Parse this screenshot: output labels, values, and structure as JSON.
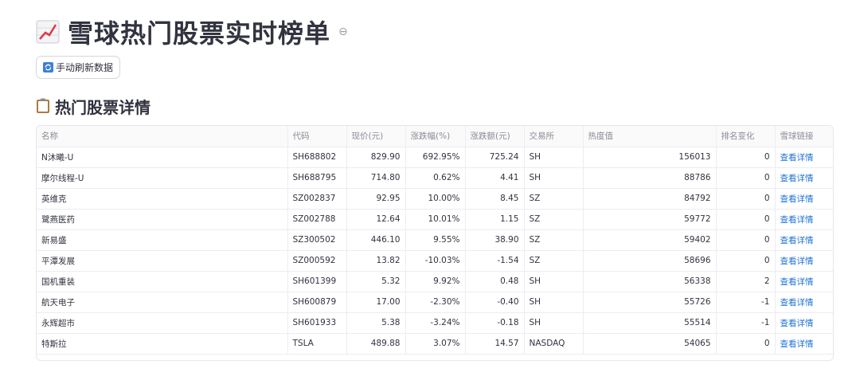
{
  "page": {
    "title": "雪球热门股票实时榜单",
    "title_icon": "chart-increasing-icon",
    "anchor_icon": "link-icon",
    "refresh_button": "手动刷新数据",
    "refresh_icon": "refresh-icon",
    "section_title": "热门股票详情",
    "section_icon": "clipboard-icon"
  },
  "colors": {
    "link": "#1e73d6",
    "text": "#31333f",
    "header_text": "#8a8c95"
  },
  "table": {
    "columns": [
      "名称",
      "代码",
      "现价(元)",
      "涨跌幅(%)",
      "涨跌额(元)",
      "交易所",
      "热度值",
      "排名变化",
      "雪球链接"
    ],
    "rows": [
      [
        "N沐曦-U",
        "SH688802",
        "829.90",
        "692.95%",
        "725.24",
        "SH",
        "156013",
        "0",
        "查看详情"
      ],
      [
        "摩尔线程-U",
        "SH688795",
        "714.80",
        "0.62%",
        "4.41",
        "SH",
        "88786",
        "0",
        "查看详情"
      ],
      [
        "英维克",
        "SZ002837",
        "92.95",
        "10.00%",
        "8.45",
        "SZ",
        "84792",
        "0",
        "查看详情"
      ],
      [
        "鹭燕医药",
        "SZ002788",
        "12.64",
        "10.01%",
        "1.15",
        "SZ",
        "59772",
        "0",
        "查看详情"
      ],
      [
        "新易盛",
        "SZ300502",
        "446.10",
        "9.55%",
        "38.90",
        "SZ",
        "59402",
        "0",
        "查看详情"
      ],
      [
        "平潭发展",
        "SZ000592",
        "13.82",
        "-10.03%",
        "-1.54",
        "SZ",
        "58696",
        "0",
        "查看详情"
      ],
      [
        "国机重装",
        "SH601399",
        "5.32",
        "9.92%",
        "0.48",
        "SH",
        "56338",
        "2",
        "查看详情"
      ],
      [
        "航天电子",
        "SH600879",
        "17.00",
        "-2.30%",
        "-0.40",
        "SH",
        "55726",
        "-1",
        "查看详情"
      ],
      [
        "永辉超市",
        "SH601933",
        "5.38",
        "-3.24%",
        "-0.18",
        "SH",
        "55514",
        "-1",
        "查看详情"
      ],
      [
        "特斯拉",
        "TSLA",
        "489.88",
        "3.07%",
        "14.57",
        "NASDAQ",
        "54065",
        "0",
        "查看详情"
      ]
    ]
  }
}
